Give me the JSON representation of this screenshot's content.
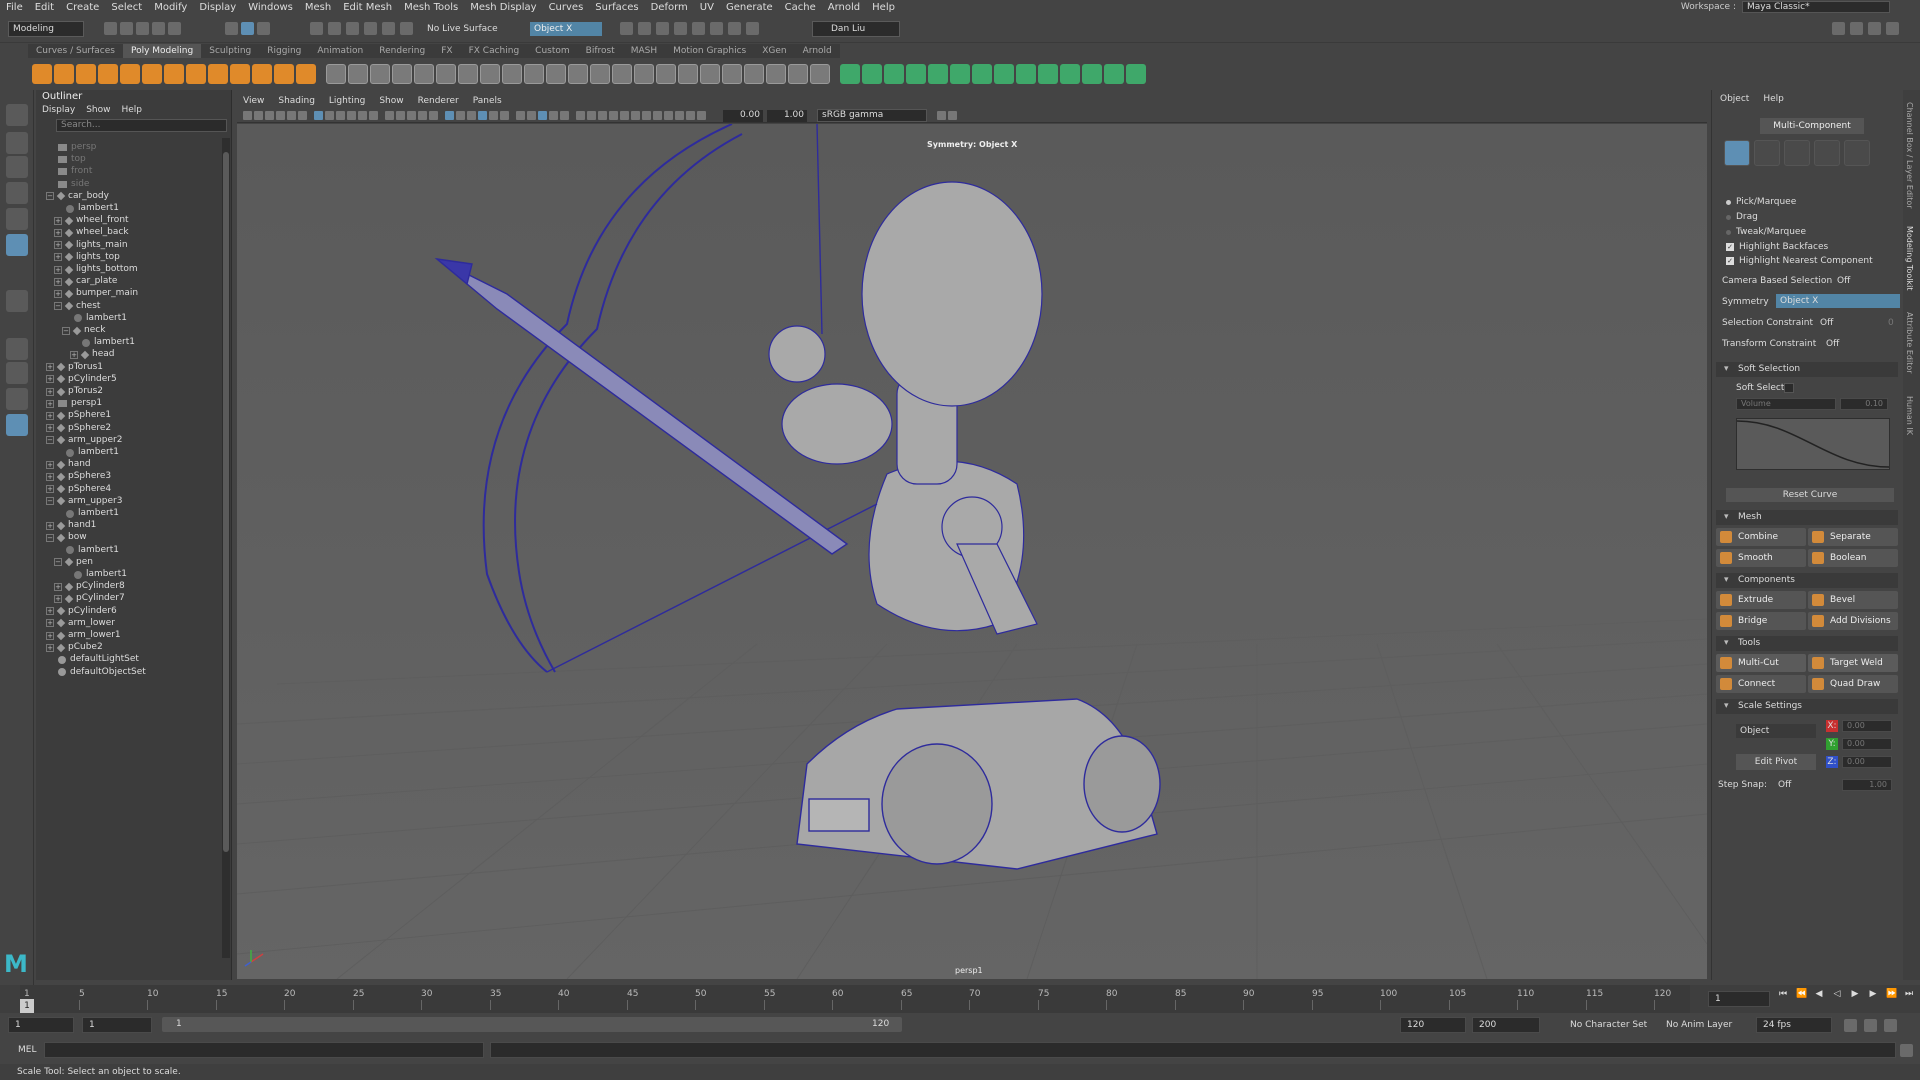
{
  "menubar": [
    "File",
    "Edit",
    "Create",
    "Select",
    "Modify",
    "Display",
    "Windows",
    "Mesh",
    "Edit Mesh",
    "Mesh Tools",
    "Mesh Display",
    "Curves",
    "Surfaces",
    "Deform",
    "UV",
    "Generate",
    "Cache",
    "Arnold",
    "Help"
  ],
  "workspace": {
    "label": "Workspace :",
    "value": "Maya Classic*"
  },
  "statusline": {
    "mode": "Modeling",
    "live_surface": "No Live Surface",
    "symmetry": "Object X",
    "user": "Dan Liu"
  },
  "shelf_tabs": [
    "Curves / Surfaces",
    "Poly Modeling",
    "Sculpting",
    "Rigging",
    "Animation",
    "Rendering",
    "FX",
    "FX Caching",
    "Custom",
    "Bifrost",
    "MASH",
    "Motion Graphics",
    "XGen",
    "Arnold"
  ],
  "shelf_active": "Poly Modeling",
  "outliner": {
    "title": "Outliner",
    "menu": [
      "Display",
      "Show",
      "Help"
    ],
    "search_placeholder": "Search...",
    "items": [
      {
        "label": "persp",
        "depth": 0,
        "icon": "cam",
        "exp": "",
        "dim": true
      },
      {
        "label": "top",
        "depth": 0,
        "icon": "cam",
        "exp": "",
        "dim": true
      },
      {
        "label": "front",
        "depth": 0,
        "icon": "cam",
        "exp": "",
        "dim": true
      },
      {
        "label": "side",
        "depth": 0,
        "icon": "cam",
        "exp": "",
        "dim": true
      },
      {
        "label": "car_body",
        "depth": 0,
        "icon": "tr",
        "exp": "-"
      },
      {
        "label": "lambert1",
        "depth": 1,
        "icon": "mat",
        "exp": ""
      },
      {
        "label": "wheel_front",
        "depth": 1,
        "icon": "tr",
        "exp": "+"
      },
      {
        "label": "wheel_back",
        "depth": 1,
        "icon": "tr",
        "exp": "+"
      },
      {
        "label": "lights_main",
        "depth": 1,
        "icon": "tr",
        "exp": "+"
      },
      {
        "label": "lights_top",
        "depth": 1,
        "icon": "tr",
        "exp": "+"
      },
      {
        "label": "lights_bottom",
        "depth": 1,
        "icon": "tr",
        "exp": "+"
      },
      {
        "label": "car_plate",
        "depth": 1,
        "icon": "tr",
        "exp": "+"
      },
      {
        "label": "bumper_main",
        "depth": 1,
        "icon": "tr",
        "exp": "+"
      },
      {
        "label": "chest",
        "depth": 1,
        "icon": "tr",
        "exp": "-"
      },
      {
        "label": "lambert1",
        "depth": 2,
        "icon": "mat",
        "exp": ""
      },
      {
        "label": "neck",
        "depth": 2,
        "icon": "tr",
        "exp": "-"
      },
      {
        "label": "lambert1",
        "depth": 3,
        "icon": "mat",
        "exp": ""
      },
      {
        "label": "head",
        "depth": 3,
        "icon": "tr",
        "exp": "+"
      },
      {
        "label": "pTorus1",
        "depth": 0,
        "icon": "tr",
        "exp": "+"
      },
      {
        "label": "pCylinder5",
        "depth": 0,
        "icon": "tr",
        "exp": "+"
      },
      {
        "label": "pTorus2",
        "depth": 0,
        "icon": "tr",
        "exp": "+"
      },
      {
        "label": "persp1",
        "depth": 0,
        "icon": "cam",
        "exp": "+"
      },
      {
        "label": "pSphere1",
        "depth": 0,
        "icon": "tr",
        "exp": "+"
      },
      {
        "label": "pSphere2",
        "depth": 0,
        "icon": "tr",
        "exp": "+"
      },
      {
        "label": "arm_upper2",
        "depth": 0,
        "icon": "tr",
        "exp": "-"
      },
      {
        "label": "lambert1",
        "depth": 1,
        "icon": "mat",
        "exp": ""
      },
      {
        "label": "hand",
        "depth": 0,
        "icon": "tr",
        "exp": "+"
      },
      {
        "label": "pSphere3",
        "depth": 0,
        "icon": "tr",
        "exp": "+"
      },
      {
        "label": "pSphere4",
        "depth": 0,
        "icon": "tr",
        "exp": "+"
      },
      {
        "label": "arm_upper3",
        "depth": 0,
        "icon": "tr",
        "exp": "-"
      },
      {
        "label": "lambert1",
        "depth": 1,
        "icon": "mat",
        "exp": ""
      },
      {
        "label": "hand1",
        "depth": 0,
        "icon": "tr",
        "exp": "+"
      },
      {
        "label": "bow",
        "depth": 0,
        "icon": "tr",
        "exp": "-"
      },
      {
        "label": "lambert1",
        "depth": 1,
        "icon": "mat",
        "exp": ""
      },
      {
        "label": "pen",
        "depth": 1,
        "icon": "tr",
        "exp": "-"
      },
      {
        "label": "lambert1",
        "depth": 2,
        "icon": "mat",
        "exp": ""
      },
      {
        "label": "pCylinder8",
        "depth": 1,
        "icon": "tr",
        "exp": "+"
      },
      {
        "label": "pCylinder7",
        "depth": 1,
        "icon": "tr",
        "exp": "+"
      },
      {
        "label": "pCylinder6",
        "depth": 0,
        "icon": "tr",
        "exp": "+"
      },
      {
        "label": "arm_lower",
        "depth": 0,
        "icon": "tr",
        "exp": "+"
      },
      {
        "label": "arm_lower1",
        "depth": 0,
        "icon": "tr",
        "exp": "+"
      },
      {
        "label": "pCube2",
        "depth": 0,
        "icon": "tr",
        "exp": "+"
      },
      {
        "label": "defaultLightSet",
        "depth": 0,
        "icon": "set",
        "exp": ""
      },
      {
        "label": "defaultObjectSet",
        "depth": 0,
        "icon": "set",
        "exp": ""
      }
    ]
  },
  "viewport": {
    "menu": [
      "View",
      "Shading",
      "Lighting",
      "Show",
      "Renderer",
      "Panels"
    ],
    "field_a": "0.00",
    "field_b": "1.00",
    "colorspace": "sRGB gamma",
    "symmetry_label": "Symmetry: Object X",
    "camera_label": "persp1"
  },
  "modeling_toolkit": {
    "menu": [
      "Object",
      "Help"
    ],
    "mode": "Multi-Component",
    "pick_marquee": "Pick/Marquee",
    "drag": "Drag",
    "tweak_marquee": "Tweak/Marquee",
    "highlight_backfaces": "Highlight Backfaces",
    "highlight_nearest": "Highlight Nearest Component",
    "camera_based_label": "Camera Based Selection",
    "camera_based_value": "Off",
    "symmetry_label": "Symmetry",
    "symmetry_value": "Object X",
    "selection_constraint_label": "Selection Constraint",
    "selection_constraint_value": "Off",
    "selection_constraint_num": "0",
    "transform_constraint_label": "Transform Constraint",
    "transform_constraint_value": "Off",
    "soft_selection": "Soft Selection",
    "soft_select": "Soft Select:",
    "volume": "Volume",
    "volume_value": "0.10",
    "reset_curve": "Reset Curve",
    "mesh_section": "Mesh",
    "combine": "Combine",
    "separate": "Separate",
    "smooth": "Smooth",
    "boolean": "Boolean",
    "components_section": "Components",
    "extrude": "Extrude",
    "bevel": "Bevel",
    "bridge": "Bridge",
    "add_divisions": "Add Divisions",
    "tools_section": "Tools",
    "multi_cut": "Multi-Cut",
    "target_weld": "Target Weld",
    "connect": "Connect",
    "quad_draw": "Quad Draw",
    "scale_settings": "Scale Settings",
    "object": "Object",
    "x_label": "X:",
    "y_label": "Y:",
    "z_label": "Z:",
    "x_value": "0.00",
    "y_value": "0.00",
    "z_value": "0.00",
    "edit_pivot": "Edit Pivot",
    "step_snap_label": "Step Snap:",
    "step_snap_value": "Off",
    "step_snap_num": "1.00"
  },
  "side_tabs": [
    "Channel Box / Layer Editor",
    "Modeling Toolkit",
    "Attribute Editor",
    "Human IK"
  ],
  "timeline": {
    "ticks": [
      "1",
      "5",
      "10",
      "15",
      "20",
      "25",
      "30",
      "35",
      "40",
      "45",
      "50",
      "55",
      "60",
      "65",
      "70",
      "75",
      "80",
      "85",
      "90",
      "95",
      "100",
      "105",
      "110",
      "115",
      "120"
    ],
    "current_frame": "1",
    "current_frame_field": "1"
  },
  "range": {
    "start": "1",
    "start2": "1",
    "slider_start": "1",
    "slider_end": "120",
    "end": "120",
    "end2": "200",
    "character_set": "No Character Set",
    "anim_layer": "No Anim Layer",
    "fps": "24 fps"
  },
  "mel_label": "MEL",
  "help_line": "Scale Tool: Select an object to scale.",
  "colors": {
    "accent": "#5e8fb4",
    "wire": "#2e2b9c",
    "shelf_orange": "#e08a2a",
    "shelf_green": "#3fa86a"
  }
}
